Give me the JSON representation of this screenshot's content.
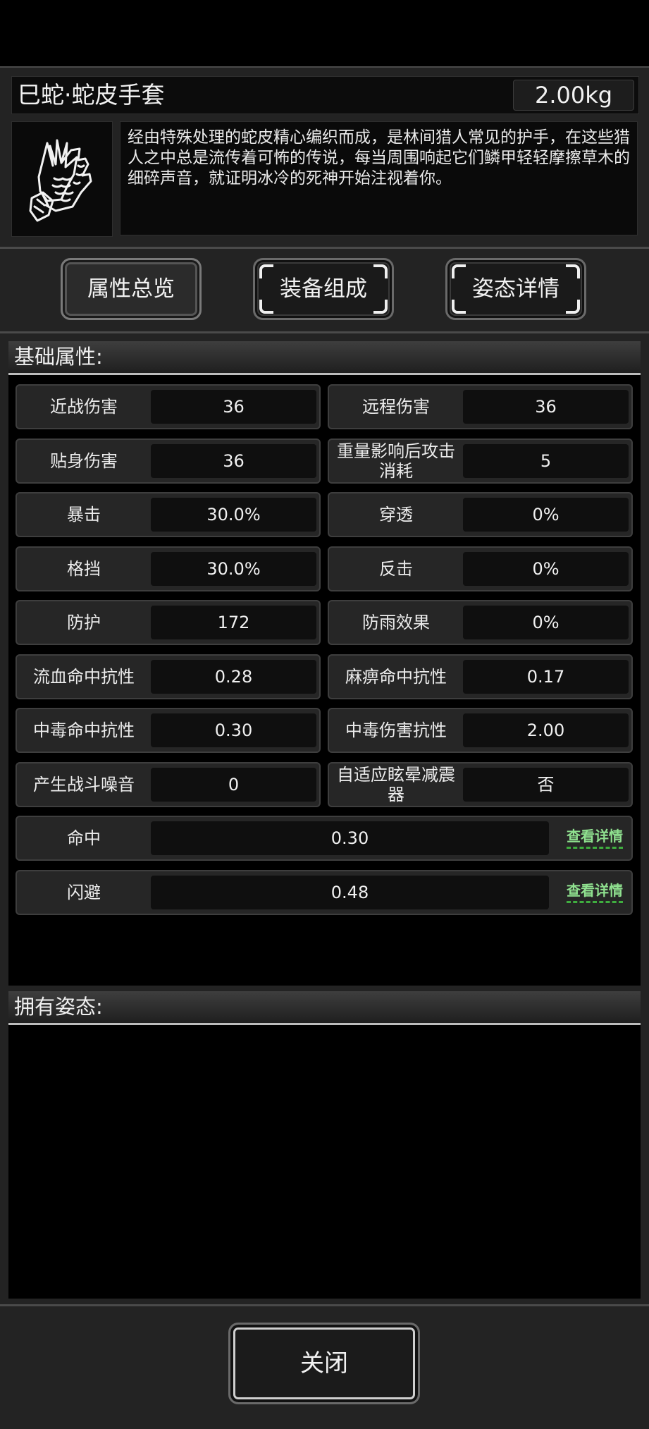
{
  "item": {
    "title": "巳蛇·蛇皮手套",
    "weight": "2.00kg",
    "icon": "snakeskin-gloves-icon",
    "description": "经由特殊处理的蛇皮精心编织而成，是林间猎人常见的护手，在这些猎人之中总是流传着可怖的传说，每当周围响起它们鳞甲轻轻摩擦草木的细碎声音，就证明冰冷的死神开始注视着你。"
  },
  "tabs": [
    {
      "label": "属性总览",
      "active": true
    },
    {
      "label": "装备组成",
      "active": false
    },
    {
      "label": "姿态详情",
      "active": false
    }
  ],
  "base_section": {
    "title": "基础属性:",
    "stats": [
      {
        "label": "近战伤害",
        "value": "36"
      },
      {
        "label": "远程伤害",
        "value": "36"
      },
      {
        "label": "贴身伤害",
        "value": "36"
      },
      {
        "label": "重量影响后攻击消耗",
        "value": "5"
      },
      {
        "label": "暴击",
        "value": "30.0%"
      },
      {
        "label": "穿透",
        "value": "0%"
      },
      {
        "label": "格挡",
        "value": "30.0%"
      },
      {
        "label": "反击",
        "value": "0%"
      },
      {
        "label": "防护",
        "value": "172"
      },
      {
        "label": "防雨效果",
        "value": "0%"
      },
      {
        "label": "流血命中抗性",
        "value": "0.28"
      },
      {
        "label": "麻痹命中抗性",
        "value": "0.17"
      },
      {
        "label": "中毒命中抗性",
        "value": "0.30"
      },
      {
        "label": "中毒伤害抗性",
        "value": "2.00"
      },
      {
        "label": "产生战斗噪音",
        "value": "0"
      },
      {
        "label": "自适应眩晕减震器",
        "value": "否"
      }
    ],
    "wide_stats": [
      {
        "label": "命中",
        "value": "0.30",
        "link": "查看详情"
      },
      {
        "label": "闪避",
        "value": "0.48",
        "link": "查看详情"
      }
    ]
  },
  "stance_section": {
    "title": "拥有姿态:"
  },
  "close_label": "关闭",
  "colors": {
    "background": "#000000",
    "panel": "#232323",
    "link_green": "#8fe08f"
  }
}
